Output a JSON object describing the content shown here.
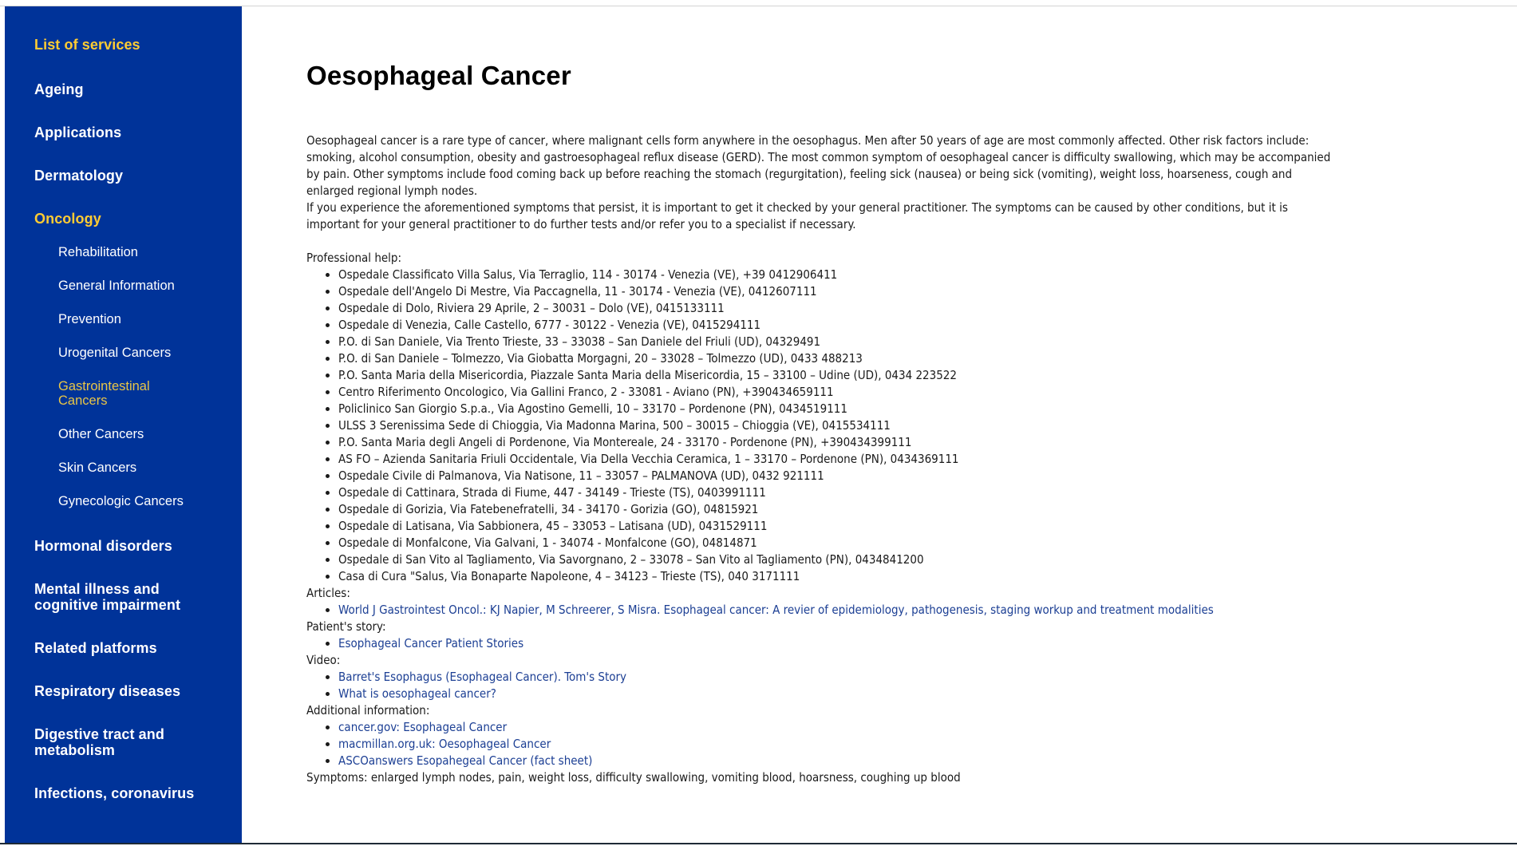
{
  "sidebar": {
    "title": "List of services",
    "items": [
      {
        "label": "Ageing"
      },
      {
        "label": "Applications"
      },
      {
        "label": "Dermatology"
      },
      {
        "label": "Oncology",
        "active": true,
        "children": [
          {
            "label": "Rehabilitation"
          },
          {
            "label": "General Information"
          },
          {
            "label": "Prevention"
          },
          {
            "label": "Urogenital Cancers"
          },
          {
            "label": "Gastrointestinal Cancers",
            "active": true
          },
          {
            "label": "Other Cancers"
          },
          {
            "label": "Skin Cancers"
          },
          {
            "label": "Gynecologic Cancers"
          }
        ]
      },
      {
        "label": "Hormonal disorders"
      },
      {
        "label": "Mental illness and cognitive impairment"
      },
      {
        "label": "Related platforms"
      },
      {
        "label": "Respiratory diseases"
      },
      {
        "label": "Digestive tract and metabolism"
      },
      {
        "label": "Infections, coronavirus"
      }
    ]
  },
  "main": {
    "title": "Oesophageal Cancer",
    "intro": "Oesophageal cancer is a rare type of cancer, where malignant cells form anywhere in the oesophagus. Men after 50 years of age are most commonly affected. Other risk factors include: smoking, alcohol consumption, obesity and gastroesophageal reflux disease (GERD). The most common symptom of oesophageal cancer is difficulty swallowing, which may be accompanied by pain. Other symptoms include food coming back up before reaching the stomach (regurgitation), feeling sick (nausea) or being sick (vomiting), weight loss, hoarseness, cough and enlarged regional lymph nodes.",
    "advice": "If you experience the aforementioned symptoms that persist, it is important to get it checked by your general practitioner. The symptoms can be caused by other conditions, but it is important for your general practitioner to do further tests and/or refer you to a specialist if necessary.",
    "professional_help": {
      "label": "Professional help:",
      "items": [
        "Ospedale Classificato Villa Salus, Via Terraglio, 114 - 30174 - Venezia (VE), +39 0412906411",
        "Ospedale dell'Angelo Di Mestre, Via Paccagnella, 11 - 30174 - Venezia (VE), 0412607111",
        "Ospedale di Dolo, Riviera 29 Aprile, 2 – 30031 – Dolo (VE), 0415133111",
        "Ospedale di Venezia, Calle Castello, 6777 - 30122 - Venezia (VE), 0415294111",
        "P.O. di San Daniele, Via Trento Trieste, 33 – 33038 – San Daniele del Friuli (UD), 04329491",
        "P.O. di San Daniele – Tolmezzo, Via Giobatta Morgagni, 20 – 33028 – Tolmezzo (UD), 0433 488213",
        "P.O. Santa Maria della Misericordia, Piazzale Santa Maria della Misericordia, 15 – 33100 – Udine (UD), 0434 223522",
        "Centro Riferimento Oncologico, Via Gallini Franco, 2 - 33081 - Aviano (PN), +390434659111",
        "Policlinico San Giorgio S.p.a., Via Agostino Gemelli, 10 – 33170 – Pordenone (PN), 0434519111",
        "ULSS 3 Serenissima Sede di Chioggia, Via Madonna Marina, 500 – 30015 – Chioggia (VE), 0415534111",
        " P.O. Santa Maria degli Angeli di Pordenone, Via Montereale, 24 - 33170 - Pordenone (PN), +390434399111",
        "AS FO – Azienda Sanitaria Friuli Occidentale, Via Della Vecchia Ceramica, 1 – 33170 – Pordenone (PN), 0434369111",
        "Ospedale Civile di Palmanova, Via Natisone, 11 – 33057 – PALMANOVA (UD), 0432 921111",
        "Ospedale di Cattinara, Strada di Fiume, 447 - 34149 - Trieste (TS), 0403991111",
        "Ospedale di Gorizia, Via Fatebenefratelli, 34 - 34170 - Gorizia (GO), 04815921",
        "Ospedale di Latisana, Via Sabbionera, 45 – 33053 – Latisana (UD), 0431529111",
        "Ospedale di Monfalcone, Via Galvani, 1 - 34074 - Monfalcone (GO), 04814871",
        "Ospedale di San Vito al Tagliamento, Via Savorgnano, 2 – 33078 – San Vito al Tagliamento (PN), 0434841200",
        "Casa di Cura \"Salus, Via Bonaparte Napoleone, 4 – 34123 – Trieste (TS), 040 3171111"
      ]
    },
    "articles": {
      "label": "Articles:",
      "links": [
        "World J Gastrointest Oncol.: KJ Napier, M Schreerer, S Misra. Esophageal cancer: A revier of epidemiology, pathogenesis, staging workup and treatment modalities"
      ]
    },
    "patient_story": {
      "label": "Patient's story:",
      "links": [
        "Esophageal Cancer Patient Stories"
      ]
    },
    "video": {
      "label": "Video:",
      "links": [
        "Barret's Esophagus (Esophageal Cancer). Tom's Story",
        "What is oesophageal cancer?"
      ]
    },
    "additional": {
      "label": "Additional information:",
      "links": [
        "cancer.gov: Esophageal Cancer",
        "macmillan.org.uk: Oesophageal Cancer",
        "ASCOanswers Esopahegeal Cancer (fact sheet)"
      ]
    },
    "symptoms": "Symptoms: enlarged lymph nodes, pain, weight loss, difficulty swallowing, vomiting blood, hoarsness, coughing up blood"
  },
  "colors": {
    "sidebar_bg": "#003399",
    "sidebar_active": "#ffcc33",
    "link": "#1c3f94"
  }
}
